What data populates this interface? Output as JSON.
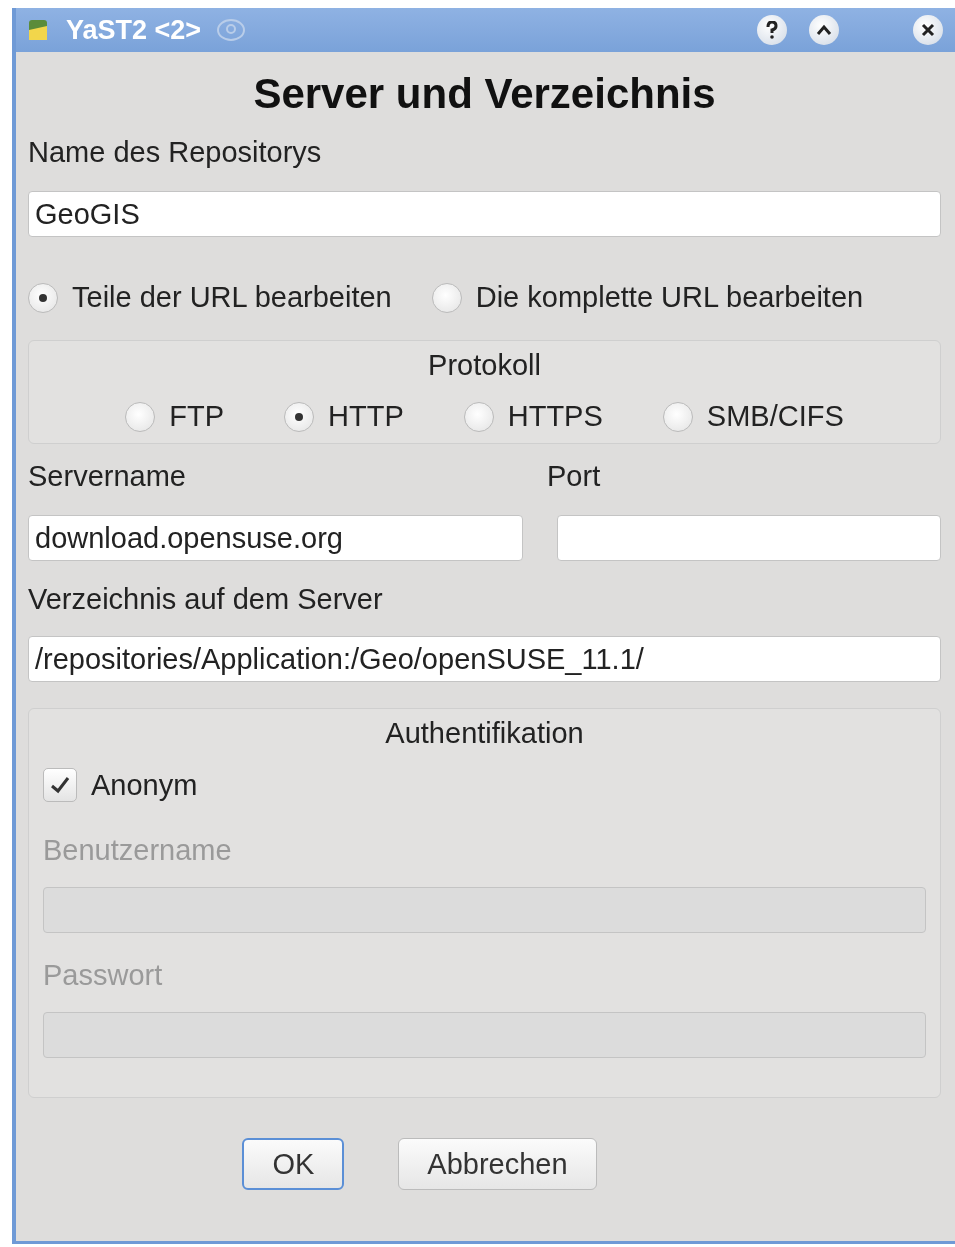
{
  "window": {
    "title": "YaST2 <2>"
  },
  "heading": "Server und Verzeichnis",
  "repo_name": {
    "label": "Name des Repositorys",
    "value": "GeoGIS"
  },
  "edit_mode": [
    {
      "label": "Teile der URL bearbeiten",
      "selected": true
    },
    {
      "label": "Die komplette URL bearbeiten",
      "selected": false
    }
  ],
  "protocol": {
    "title": "Protokoll",
    "options": [
      {
        "label": "FTP",
        "selected": false
      },
      {
        "label": "HTTP",
        "selected": true
      },
      {
        "label": "HTTPS",
        "selected": false
      },
      {
        "label": "SMB/CIFS",
        "selected": false
      }
    ]
  },
  "server": {
    "label": "Servername",
    "value": "download.opensuse.org"
  },
  "port": {
    "label": "Port"
  },
  "directory": {
    "label": "Verzeichnis auf dem Server",
    "value": "/repositories/Application:/Geo/openSUSE_11.1/"
  },
  "auth": {
    "title": "Authentifikation",
    "anonymous": {
      "label": "Anonym",
      "checked": true
    },
    "fields": [
      {
        "label": "Benutzername",
        "disabled": true
      },
      {
        "label": "Passwort",
        "disabled": true
      }
    ]
  },
  "buttons": [
    {
      "label": "OK",
      "selected": true
    },
    {
      "label": "Abbrechen",
      "selected": false
    }
  ]
}
